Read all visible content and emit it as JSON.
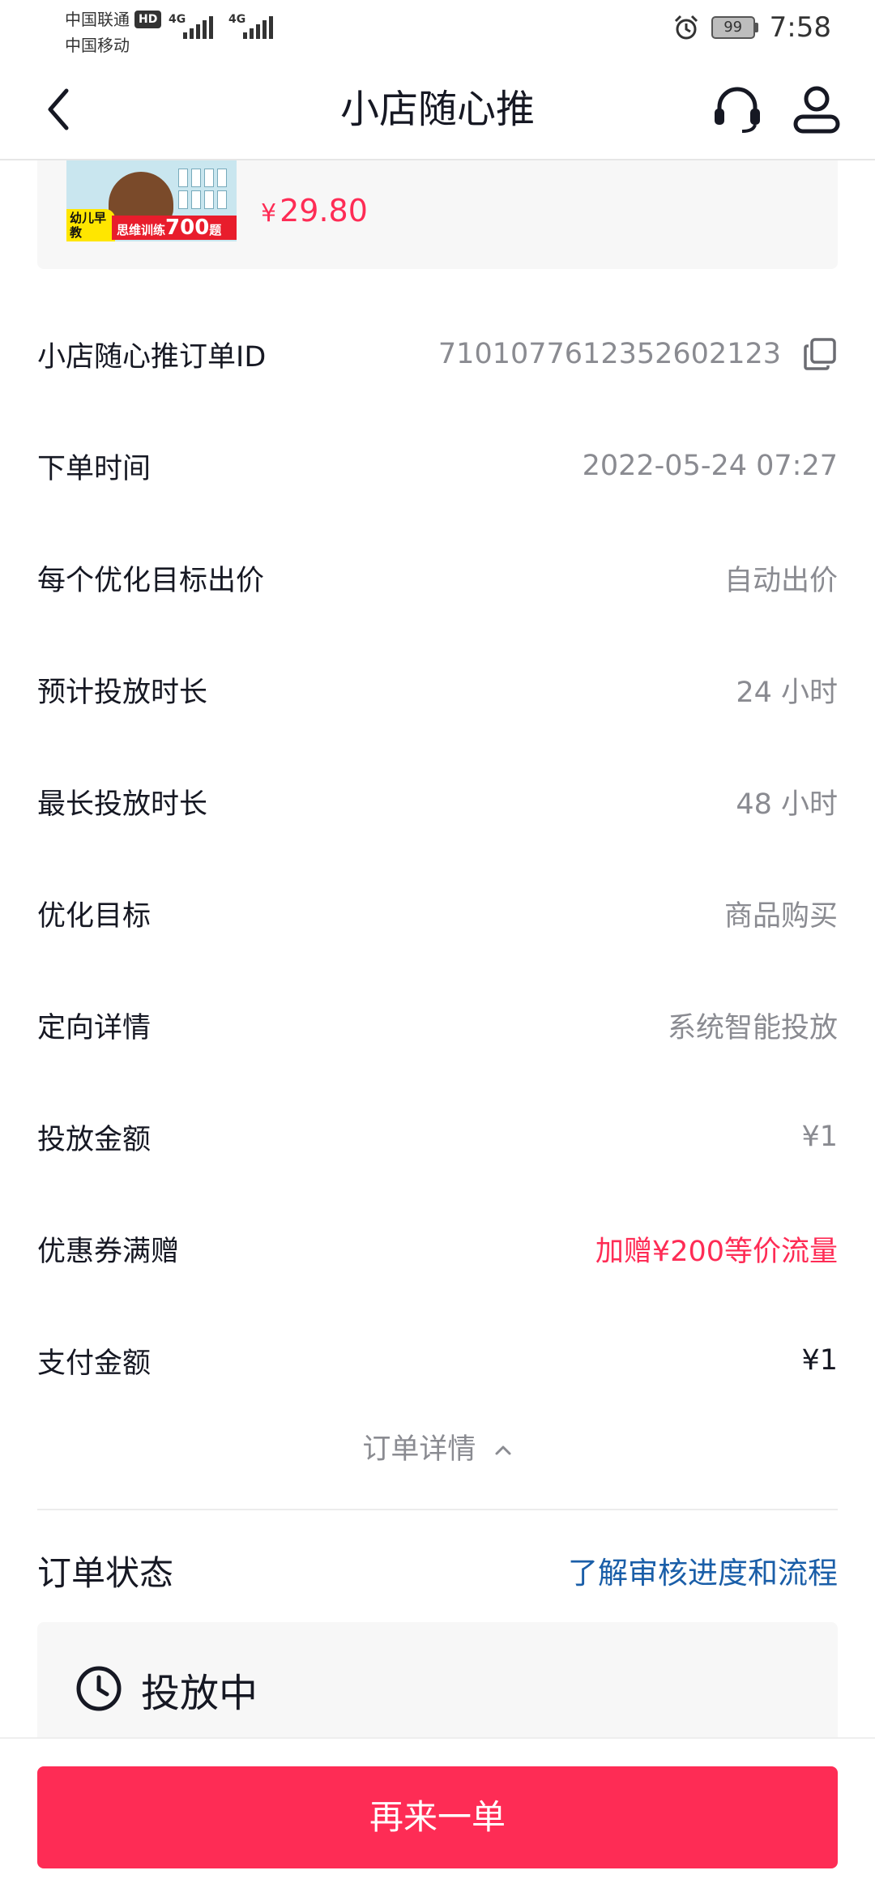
{
  "status_bar": {
    "carrier_1": "中国联通",
    "hd_badge": "HD",
    "carrier_2": "中国移动",
    "net_1": "4G",
    "net_2": "4G",
    "battery": "99",
    "time": "7:58"
  },
  "nav": {
    "title": "小店随心推"
  },
  "product": {
    "currency": "¥",
    "price": "29.80",
    "image_tag": "幼儿早教",
    "image_banner_prefix": "思维训练",
    "image_banner_number": "700",
    "image_banner_suffix": "题"
  },
  "rows": [
    {
      "label": "小店随心推订单ID",
      "value": "7101077612352602123"
    },
    {
      "label": "下单时间",
      "value": "2022-05-24 07:27"
    },
    {
      "label": "每个优化目标出价",
      "value": "自动出价"
    },
    {
      "label": "预计投放时长",
      "value": "24 小时"
    },
    {
      "label": "最长投放时长",
      "value": "48 小时"
    },
    {
      "label": "优化目标",
      "value": "商品购买"
    },
    {
      "label": "定向详情",
      "value": "系统智能投放"
    },
    {
      "label": "投放金额",
      "value": "¥1"
    },
    {
      "label": "优惠券满赠",
      "value": "加赠¥200等价流量"
    },
    {
      "label": "支付金额",
      "value": "¥1"
    }
  ],
  "details_toggle": "订单详情",
  "order_status": {
    "title": "订单状态",
    "link": "了解审核进度和流程",
    "state": "投放中"
  },
  "cta": {
    "label": "再来一单"
  },
  "colors": {
    "accent": "#fe2c55",
    "link": "#1a5ea8",
    "muted": "#8a8b91"
  }
}
